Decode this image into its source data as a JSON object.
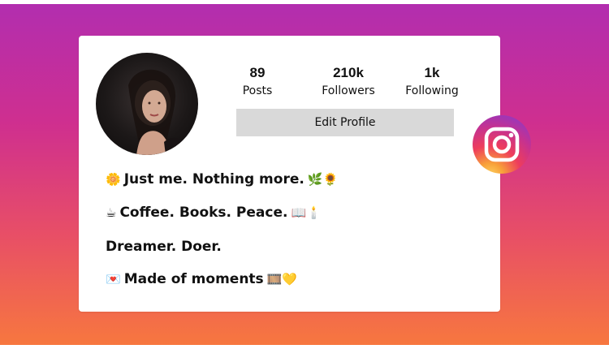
{
  "profile": {
    "stats": [
      {
        "value": "89",
        "label": "Posts"
      },
      {
        "value": "210k",
        "label": "Followers"
      },
      {
        "value": "1k",
        "label": "Following"
      }
    ],
    "edit_button_label": "Edit Profile"
  },
  "bio": {
    "lines": [
      {
        "emoji_before": "🌼",
        "text": "Just me. Nothing more.",
        "emoji_after": "🌿🌻"
      },
      {
        "emoji_before": "☕",
        "text": "Coffee. Books. Peace.",
        "emoji_after": "📖🕯️"
      },
      {
        "emoji_before": "",
        "text": "Dreamer. Doer.",
        "emoji_after": ""
      },
      {
        "emoji_before": "💌",
        "text": "Made of moments",
        "emoji_after": "🎞️💛"
      }
    ]
  },
  "colors": {
    "gradient_top": "#b22eaf",
    "gradient_bottom": "#f7773f",
    "button_bg": "#d9d9d9"
  },
  "icons": {
    "avatar": "profile-photo",
    "badge": "instagram-logo-icon"
  }
}
